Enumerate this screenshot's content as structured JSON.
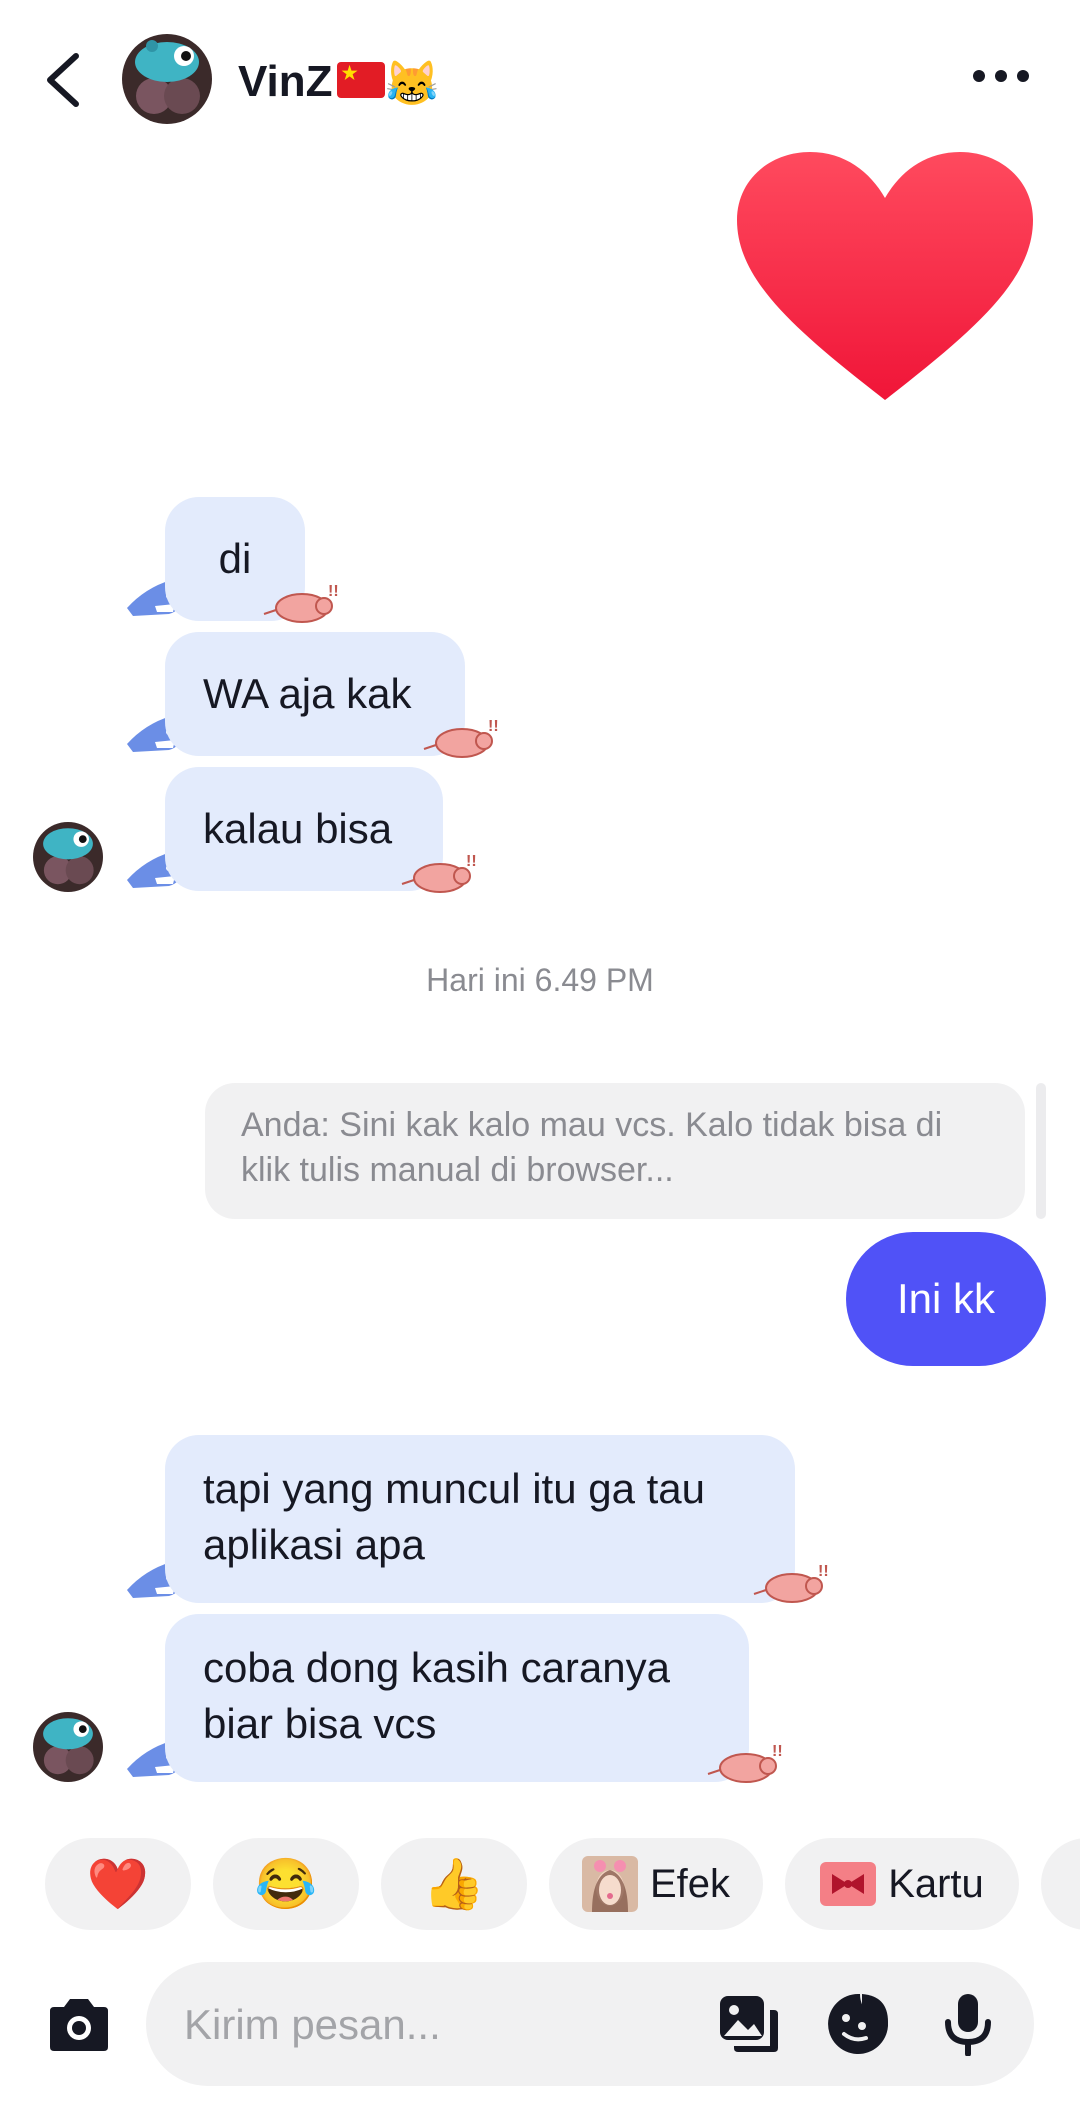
{
  "header": {
    "contact_name": "VinZ",
    "name_emoji": "😹"
  },
  "messages": [
    {
      "from": "them",
      "text": "di"
    },
    {
      "from": "them",
      "text": "WA aja kak"
    },
    {
      "from": "them",
      "text": "kalau bisa"
    },
    {
      "from": "me",
      "text": "Ini kk"
    },
    {
      "from": "them",
      "text": "tapi yang muncul itu ga tau aplikasi apa"
    },
    {
      "from": "them",
      "text": "coba dong kasih caranya biar bisa vcs"
    }
  ],
  "timestamp": "Hari ini 6.49 PM",
  "reply_preview": {
    "text": "Anda: Sini kak kalo mau vcs. Kalo tidak bisa di klik tulis manual di browser..."
  },
  "quick_reactions": [
    {
      "icon": "red-heart",
      "emoji": "❤️"
    },
    {
      "icon": "laughing-face",
      "emoji": "😂"
    },
    {
      "icon": "thumbs-up",
      "emoji": "👍"
    },
    {
      "icon": "effect-thumbnail",
      "label": "Efek"
    },
    {
      "icon": "gift-card",
      "label": "Kartu"
    }
  ],
  "input": {
    "placeholder": "Kirim pesan..."
  },
  "colors": {
    "incoming_bubble": "#e3ebfc",
    "outgoing_bubble": "#5052f7",
    "heart": "#fe2c55"
  }
}
